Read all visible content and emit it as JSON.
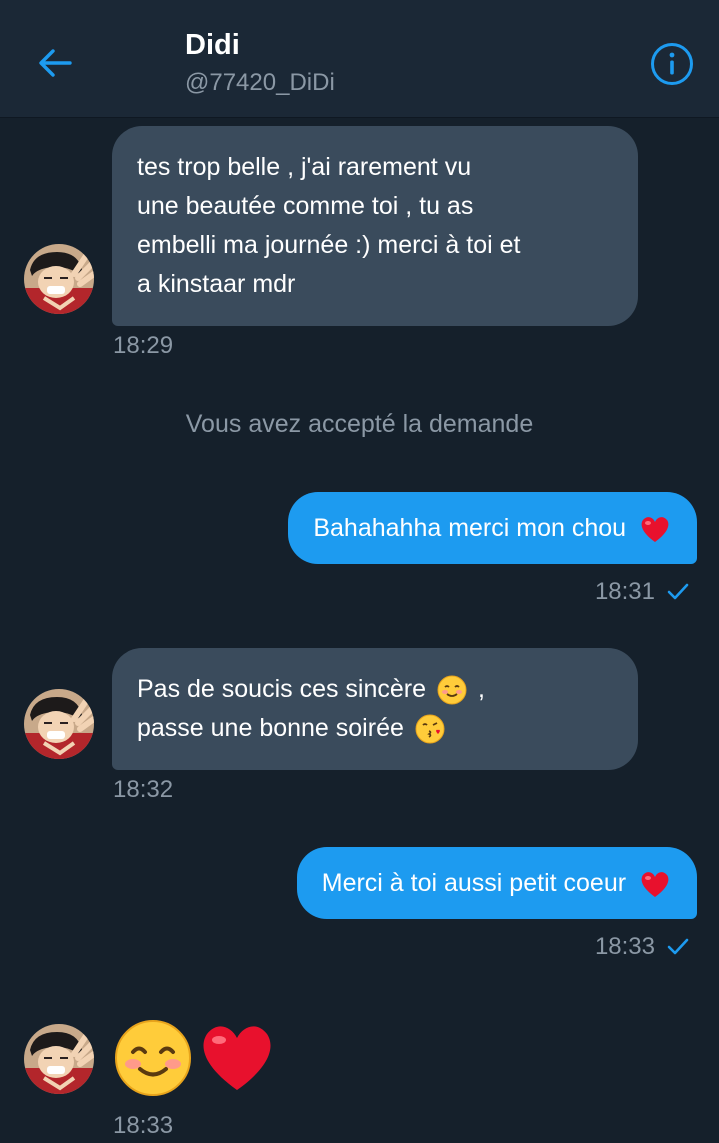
{
  "header": {
    "title": "Didi",
    "handle": "@77420_DiDi",
    "back_icon": "arrow-left-icon",
    "info_icon": "info-icon"
  },
  "messages": {
    "m1": {
      "text": "tes trop belle , j'ai rarement vu une beautée comme toi , tu as embelli ma journée :) merci à toi et a kinstaar mdr",
      "line1": "tes trop belle , j'ai rarement vu",
      "line2": "une beautée comme toi , tu as",
      "line3": "embelli ma journée :) merci à toi et",
      "line4": "a kinstaar mdr",
      "time": "18:29"
    },
    "system": "Vous avez accepté la demande",
    "m2": {
      "text": "Bahahahha merci mon chou",
      "time": "18:31"
    },
    "m3": {
      "line1": "Pas de soucis ces sincère",
      "line1_tail": ",",
      "line2": "passe une bonne soirée",
      "time": "18:32"
    },
    "m4": {
      "text": "Merci à toi aussi petit coeur",
      "time": "18:33"
    },
    "m5": {
      "time": "18:33"
    }
  },
  "colors": {
    "background": "#15202b",
    "header": "#1b2836",
    "incoming_bubble": "#3a4b5c",
    "outgoing_bubble": "#1d9bf0",
    "accent": "#1d9bf0",
    "secondary_text": "#8b98a5"
  }
}
